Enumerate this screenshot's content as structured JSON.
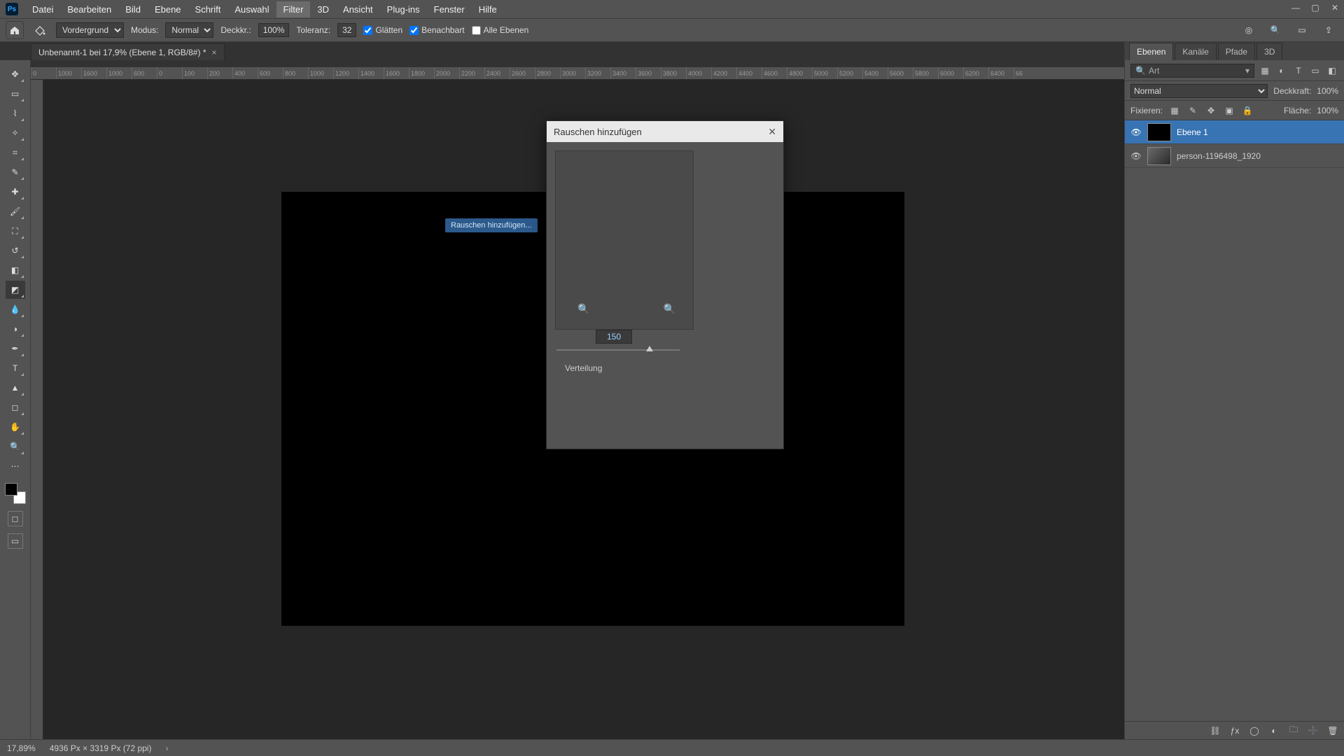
{
  "menubar": {
    "logo": "Ps",
    "items": [
      "Datei",
      "Bearbeiten",
      "Bild",
      "Ebene",
      "Schrift",
      "Auswahl",
      "Filter",
      "3D",
      "Ansicht",
      "Plug-ins",
      "Fenster",
      "Hilfe"
    ],
    "active_index": 6
  },
  "window_buttons": {
    "min": "—",
    "max": "▢",
    "close": "✕"
  },
  "optbar": {
    "tool_preset": "Vordergrund",
    "mode_label": "Modus:",
    "mode_value": "Normal",
    "opacity_label": "Deckkr.:",
    "opacity_value": "100%",
    "tolerance_label": "Toleranz:",
    "tolerance_value": "32",
    "antialias": "Glätten",
    "contiguous": "Benachbart",
    "all_layers": "Alle Ebenen"
  },
  "doc_tab": {
    "title": "Unbenannt-1 bei 17,9% (Ebene 1, RGB/8#) *"
  },
  "ruler_ticks": [
    "0",
    "1000",
    "1600",
    "1000",
    "600",
    "0",
    "100",
    "200",
    "400",
    "600",
    "800",
    "1000",
    "1200",
    "1400",
    "1600",
    "1800",
    "2000",
    "2200",
    "2400",
    "2600",
    "2800",
    "3000",
    "3200",
    "3400",
    "3600",
    "3800",
    "4000",
    "4200",
    "4400",
    "4600",
    "4800",
    "5000",
    "5200",
    "5400",
    "5600",
    "5800",
    "6000",
    "6200",
    "6400",
    "66"
  ],
  "tooltip": {
    "text": "Rauschen hinzufügen..."
  },
  "dialog": {
    "title": "Rauschen hinzufügen",
    "amount": "150",
    "section": "Verteilung"
  },
  "panels": {
    "tabs": [
      "Ebenen",
      "Kanäle",
      "Pfade",
      "3D"
    ],
    "active_tab": 0,
    "search_placeholder": "Art",
    "blend_mode": "Normal",
    "opacity_label": "Deckkraft:",
    "opacity_value": "100%",
    "lock_label": "Fixieren:",
    "fill_label": "Fläche:",
    "fill_value": "100%",
    "layers": [
      {
        "name": "Ebene 1",
        "selected": true,
        "thumb": "black"
      },
      {
        "name": "person-1196498_1920",
        "selected": false,
        "thumb": "img"
      }
    ]
  },
  "status": {
    "zoom": "17,89%",
    "doc_info": "4936 Px × 3319 Px (72 ppi)"
  }
}
